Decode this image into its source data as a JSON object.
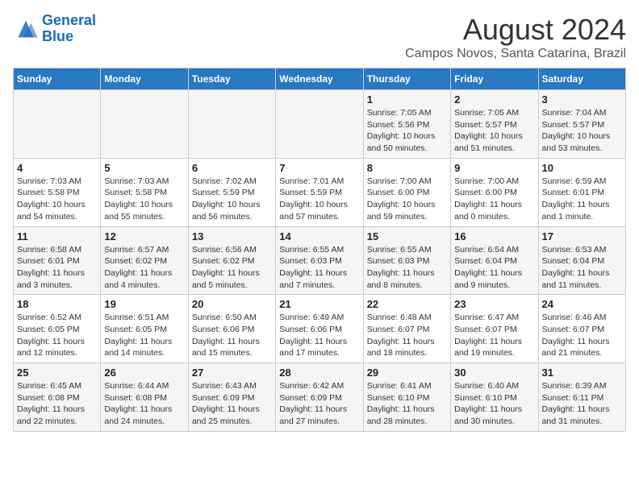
{
  "header": {
    "logo_line1": "General",
    "logo_line2": "Blue",
    "month_title": "August 2024",
    "location": "Campos Novos, Santa Catarina, Brazil"
  },
  "weekdays": [
    "Sunday",
    "Monday",
    "Tuesday",
    "Wednesday",
    "Thursday",
    "Friday",
    "Saturday"
  ],
  "weeks": [
    [
      {
        "day": "",
        "info": ""
      },
      {
        "day": "",
        "info": ""
      },
      {
        "day": "",
        "info": ""
      },
      {
        "day": "",
        "info": ""
      },
      {
        "day": "1",
        "info": "Sunrise: 7:05 AM\nSunset: 5:56 PM\nDaylight: 10 hours\nand 50 minutes."
      },
      {
        "day": "2",
        "info": "Sunrise: 7:05 AM\nSunset: 5:57 PM\nDaylight: 10 hours\nand 51 minutes."
      },
      {
        "day": "3",
        "info": "Sunrise: 7:04 AM\nSunset: 5:57 PM\nDaylight: 10 hours\nand 53 minutes."
      }
    ],
    [
      {
        "day": "4",
        "info": "Sunrise: 7:03 AM\nSunset: 5:58 PM\nDaylight: 10 hours\nand 54 minutes."
      },
      {
        "day": "5",
        "info": "Sunrise: 7:03 AM\nSunset: 5:58 PM\nDaylight: 10 hours\nand 55 minutes."
      },
      {
        "day": "6",
        "info": "Sunrise: 7:02 AM\nSunset: 5:59 PM\nDaylight: 10 hours\nand 56 minutes."
      },
      {
        "day": "7",
        "info": "Sunrise: 7:01 AM\nSunset: 5:59 PM\nDaylight: 10 hours\nand 57 minutes."
      },
      {
        "day": "8",
        "info": "Sunrise: 7:00 AM\nSunset: 6:00 PM\nDaylight: 10 hours\nand 59 minutes."
      },
      {
        "day": "9",
        "info": "Sunrise: 7:00 AM\nSunset: 6:00 PM\nDaylight: 11 hours\nand 0 minutes."
      },
      {
        "day": "10",
        "info": "Sunrise: 6:59 AM\nSunset: 6:01 PM\nDaylight: 11 hours\nand 1 minute."
      }
    ],
    [
      {
        "day": "11",
        "info": "Sunrise: 6:58 AM\nSunset: 6:01 PM\nDaylight: 11 hours\nand 3 minutes."
      },
      {
        "day": "12",
        "info": "Sunrise: 6:57 AM\nSunset: 6:02 PM\nDaylight: 11 hours\nand 4 minutes."
      },
      {
        "day": "13",
        "info": "Sunrise: 6:56 AM\nSunset: 6:02 PM\nDaylight: 11 hours\nand 5 minutes."
      },
      {
        "day": "14",
        "info": "Sunrise: 6:55 AM\nSunset: 6:03 PM\nDaylight: 11 hours\nand 7 minutes."
      },
      {
        "day": "15",
        "info": "Sunrise: 6:55 AM\nSunset: 6:03 PM\nDaylight: 11 hours\nand 8 minutes."
      },
      {
        "day": "16",
        "info": "Sunrise: 6:54 AM\nSunset: 6:04 PM\nDaylight: 11 hours\nand 9 minutes."
      },
      {
        "day": "17",
        "info": "Sunrise: 6:53 AM\nSunset: 6:04 PM\nDaylight: 11 hours\nand 11 minutes."
      }
    ],
    [
      {
        "day": "18",
        "info": "Sunrise: 6:52 AM\nSunset: 6:05 PM\nDaylight: 11 hours\nand 12 minutes."
      },
      {
        "day": "19",
        "info": "Sunrise: 6:51 AM\nSunset: 6:05 PM\nDaylight: 11 hours\nand 14 minutes."
      },
      {
        "day": "20",
        "info": "Sunrise: 6:50 AM\nSunset: 6:06 PM\nDaylight: 11 hours\nand 15 minutes."
      },
      {
        "day": "21",
        "info": "Sunrise: 6:49 AM\nSunset: 6:06 PM\nDaylight: 11 hours\nand 17 minutes."
      },
      {
        "day": "22",
        "info": "Sunrise: 6:48 AM\nSunset: 6:07 PM\nDaylight: 11 hours\nand 18 minutes."
      },
      {
        "day": "23",
        "info": "Sunrise: 6:47 AM\nSunset: 6:07 PM\nDaylight: 11 hours\nand 19 minutes."
      },
      {
        "day": "24",
        "info": "Sunrise: 6:46 AM\nSunset: 6:07 PM\nDaylight: 11 hours\nand 21 minutes."
      }
    ],
    [
      {
        "day": "25",
        "info": "Sunrise: 6:45 AM\nSunset: 6:08 PM\nDaylight: 11 hours\nand 22 minutes."
      },
      {
        "day": "26",
        "info": "Sunrise: 6:44 AM\nSunset: 6:08 PM\nDaylight: 11 hours\nand 24 minutes."
      },
      {
        "day": "27",
        "info": "Sunrise: 6:43 AM\nSunset: 6:09 PM\nDaylight: 11 hours\nand 25 minutes."
      },
      {
        "day": "28",
        "info": "Sunrise: 6:42 AM\nSunset: 6:09 PM\nDaylight: 11 hours\nand 27 minutes."
      },
      {
        "day": "29",
        "info": "Sunrise: 6:41 AM\nSunset: 6:10 PM\nDaylight: 11 hours\nand 28 minutes."
      },
      {
        "day": "30",
        "info": "Sunrise: 6:40 AM\nSunset: 6:10 PM\nDaylight: 11 hours\nand 30 minutes."
      },
      {
        "day": "31",
        "info": "Sunrise: 6:39 AM\nSunset: 6:11 PM\nDaylight: 11 hours\nand 31 minutes."
      }
    ]
  ]
}
